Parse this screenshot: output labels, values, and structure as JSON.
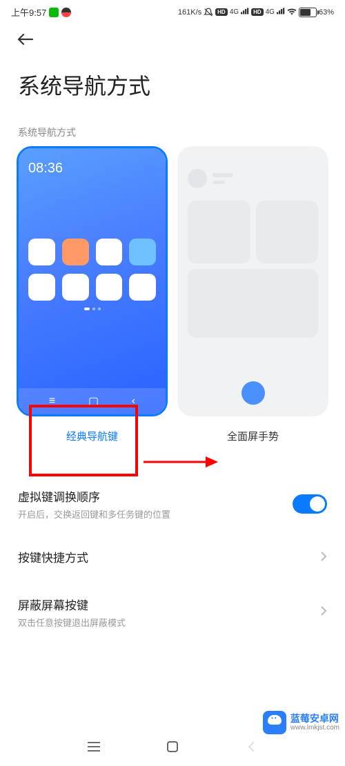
{
  "status": {
    "time": "上午9:57",
    "speed": "161K/s",
    "net": "4G",
    "battery_pct": "63%"
  },
  "page": {
    "title": "系统导航方式",
    "section_label": "系统导航方式"
  },
  "options": {
    "classic": {
      "label": "经典导航键",
      "preview_time": "08:36",
      "icon_colors": [
        "#ffffff",
        "#ff9a66",
        "#ffffff",
        "#6fc0ff",
        "#ffffff",
        "#ffffff",
        "#ffffff",
        "#ffffff"
      ],
      "selected": true
    },
    "gesture": {
      "label": "全面屏手势",
      "selected": false
    }
  },
  "settings": {
    "swap": {
      "title": "虚拟键调换顺序",
      "desc": "开启后，交换返回键和多任务键的位置"
    },
    "shortcut": {
      "title": "按键快捷方式"
    },
    "shield": {
      "title": "屏蔽屏幕按键",
      "desc": "双击任意按键退出屏蔽模式"
    }
  },
  "watermark": {
    "line1": "蓝莓安卓网",
    "line2": "www.lmkjst.com"
  }
}
